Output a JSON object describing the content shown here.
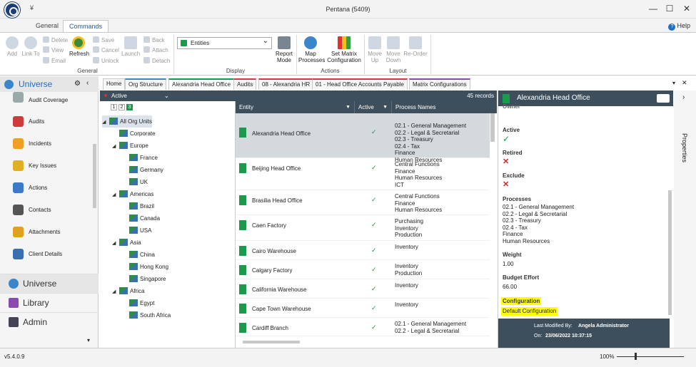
{
  "app": {
    "title": "Pentana (5409)",
    "qa": "¥"
  },
  "ribbon_tabs": [
    "General",
    "Commands"
  ],
  "help": "Help",
  "ribbon": {
    "general": {
      "add": "Add",
      "link": "Link To",
      "delete": "Delete",
      "view": "View",
      "email": "Email",
      "refresh": "Refresh",
      "save": "Save",
      "cancel": "Cancel",
      "unlock": "Unlock",
      "launch": "Launch",
      "back": "Back",
      "attach": "Attach",
      "detach": "Detach",
      "group": "General"
    },
    "display": {
      "select": "Entities",
      "report_mode": "Report Mode",
      "group": "Display"
    },
    "actions": {
      "map": "Map Processes",
      "matrix": "Set Matrix Configuration",
      "group": "Actions"
    },
    "layout": {
      "move_up": "Move Up",
      "move_down": "Move Down",
      "reorder": "Re-Order",
      "group": "Layout"
    }
  },
  "nav": {
    "title": "Universe",
    "items": [
      "Audit Coverage",
      "Audits",
      "Incidents",
      "Key Issues",
      "Actions",
      "Contacts",
      "Attachments",
      "Client Details"
    ],
    "bottom": [
      "Universe",
      "Library",
      "Admin"
    ]
  },
  "doc_tabs": [
    "Home",
    "Org Structure",
    "Alexandria Head Office",
    "Audits",
    "08 - Alexandria HR",
    "01 - Head Office Accounts Payable",
    "Matrix Configurations"
  ],
  "tree": {
    "filter": "Active",
    "levels": [
      "1",
      "2",
      "3"
    ],
    "nodes": [
      {
        "label": "All Org Units",
        "indent": 0,
        "arrow": "◢"
      },
      {
        "label": "Corporate",
        "indent": 1,
        "arrow": ""
      },
      {
        "label": "Europe",
        "indent": 1,
        "arrow": "◢"
      },
      {
        "label": "France",
        "indent": 2,
        "arrow": ""
      },
      {
        "label": "Germany",
        "indent": 2,
        "arrow": ""
      },
      {
        "label": "UK",
        "indent": 2,
        "arrow": ""
      },
      {
        "label": "Americas",
        "indent": 1,
        "arrow": "◢"
      },
      {
        "label": "Brazil",
        "indent": 2,
        "arrow": ""
      },
      {
        "label": "Canada",
        "indent": 2,
        "arrow": ""
      },
      {
        "label": "USA",
        "indent": 2,
        "arrow": ""
      },
      {
        "label": "Asia",
        "indent": 1,
        "arrow": "◢"
      },
      {
        "label": "China",
        "indent": 2,
        "arrow": ""
      },
      {
        "label": "Hong Kong",
        "indent": 2,
        "arrow": ""
      },
      {
        "label": "Singapore",
        "indent": 2,
        "arrow": ""
      },
      {
        "label": "Africa",
        "indent": 1,
        "arrow": "◢"
      },
      {
        "label": "Egypt",
        "indent": 2,
        "arrow": ""
      },
      {
        "label": "South Africa",
        "indent": 2,
        "arrow": ""
      }
    ]
  },
  "grid": {
    "records": "45 records",
    "columns": [
      "Entity",
      "Active",
      "Process Names"
    ],
    "rows": [
      {
        "entity": "Alexandria Head Office",
        "active": "✓",
        "processes": "02.1 - General Management\n02.2 - Legal & Secretarial\n02.3 - Treasury\n02.4 - Tax\nFinance\nHuman Resources"
      },
      {
        "entity": "Beijing Head Office",
        "active": "✓",
        "processes": "Central Functions\nFinance\nHuman Resources\nICT"
      },
      {
        "entity": "Brasilia Head Office",
        "active": "✓",
        "processes": "Central Functions\nFinance\nHuman Resources"
      },
      {
        "entity": "Caen Factory",
        "active": "✓",
        "processes": "Purchasing\nInventory\nProduction"
      },
      {
        "entity": "Cairo Warehouse",
        "active": "✓",
        "processes": "Inventory"
      },
      {
        "entity": "Calgary Factory",
        "active": "✓",
        "processes": "Inventory\nProduction"
      },
      {
        "entity": "California Warehouse",
        "active": "✓",
        "processes": "Inventory"
      },
      {
        "entity": "Cape Town Warehouse",
        "active": "✓",
        "processes": "Inventory"
      },
      {
        "entity": "Cardiff Branch",
        "active": "✓",
        "processes": "02.1 - General Management\n02.2 - Legal & Secretarial"
      }
    ]
  },
  "detail": {
    "title": "Alexandria Head Office",
    "owner_label": "Owner",
    "active_label": "Active",
    "retired_label": "Retired",
    "exclude_label": "Exclude",
    "processes_label": "Processes",
    "processes": "02.1 - General Management\n02.2 - Legal & Secretarial\n02.3 - Treasury\n02.4 - Tax\nFinance\nHuman Resources",
    "weight_label": "Weight",
    "weight": "1.00",
    "budget_label": "Budget Effort",
    "budget": "66.00",
    "config_label": "Configuration",
    "config": "Default Configuration",
    "modified_by_label": "Last Modified By:",
    "modified_by": "Angela Administrator",
    "on_label": "On:",
    "on": "23/06/2022 10:37:15"
  },
  "properties": "Properties",
  "status": {
    "version": "v5.4.0.9",
    "zoom": "100%"
  }
}
